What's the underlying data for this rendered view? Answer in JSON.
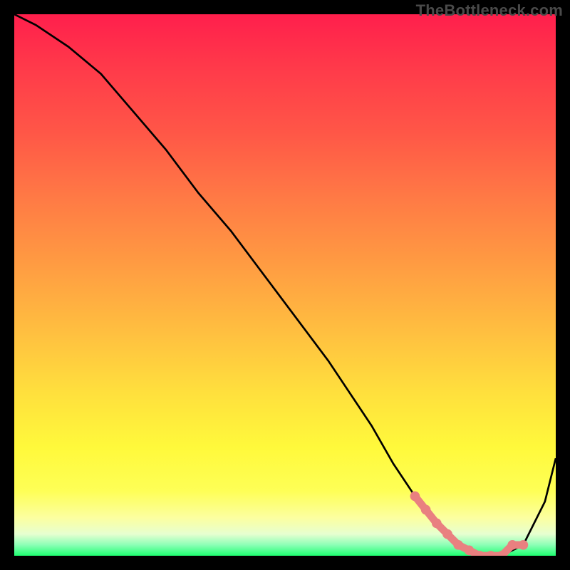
{
  "watermark": "TheBottleneck.com",
  "chart_data": {
    "type": "line",
    "title": "",
    "xlabel": "",
    "ylabel": "",
    "xlim": [
      0,
      100
    ],
    "ylim": [
      0,
      100
    ],
    "series": [
      {
        "name": "black-curve",
        "color": "#000000",
        "x": [
          0,
          4,
          10,
          16,
          22,
          28,
          34,
          40,
          46,
          52,
          58,
          62,
          66,
          70,
          74,
          78,
          82,
          86,
          90,
          94,
          98,
          100
        ],
        "values": [
          100,
          98,
          94,
          89,
          82,
          75,
          67,
          60,
          52,
          44,
          36,
          30,
          24,
          17,
          11,
          6,
          2,
          0,
          0,
          2,
          10,
          18
        ]
      },
      {
        "name": "pink-highlight",
        "color": "#e98080",
        "x": [
          74,
          78,
          82,
          86,
          88,
          90,
          92,
          94
        ],
        "values": [
          11,
          6,
          2,
          0,
          0,
          0,
          2,
          2
        ]
      }
    ],
    "gradient_stops": [
      {
        "pos": 0,
        "color": "#ff1f4c"
      },
      {
        "pos": 10,
        "color": "#ff3a4a"
      },
      {
        "pos": 22,
        "color": "#ff5747"
      },
      {
        "pos": 34,
        "color": "#ff7a45"
      },
      {
        "pos": 46,
        "color": "#ff9b42"
      },
      {
        "pos": 58,
        "color": "#ffbd40"
      },
      {
        "pos": 70,
        "color": "#ffe03d"
      },
      {
        "pos": 80,
        "color": "#fff93b"
      },
      {
        "pos": 88,
        "color": "#feff56"
      },
      {
        "pos": 93,
        "color": "#fcffa0"
      },
      {
        "pos": 96,
        "color": "#e6ffd0"
      },
      {
        "pos": 98,
        "color": "#8cffb6"
      },
      {
        "pos": 100,
        "color": "#1eff71"
      }
    ]
  }
}
